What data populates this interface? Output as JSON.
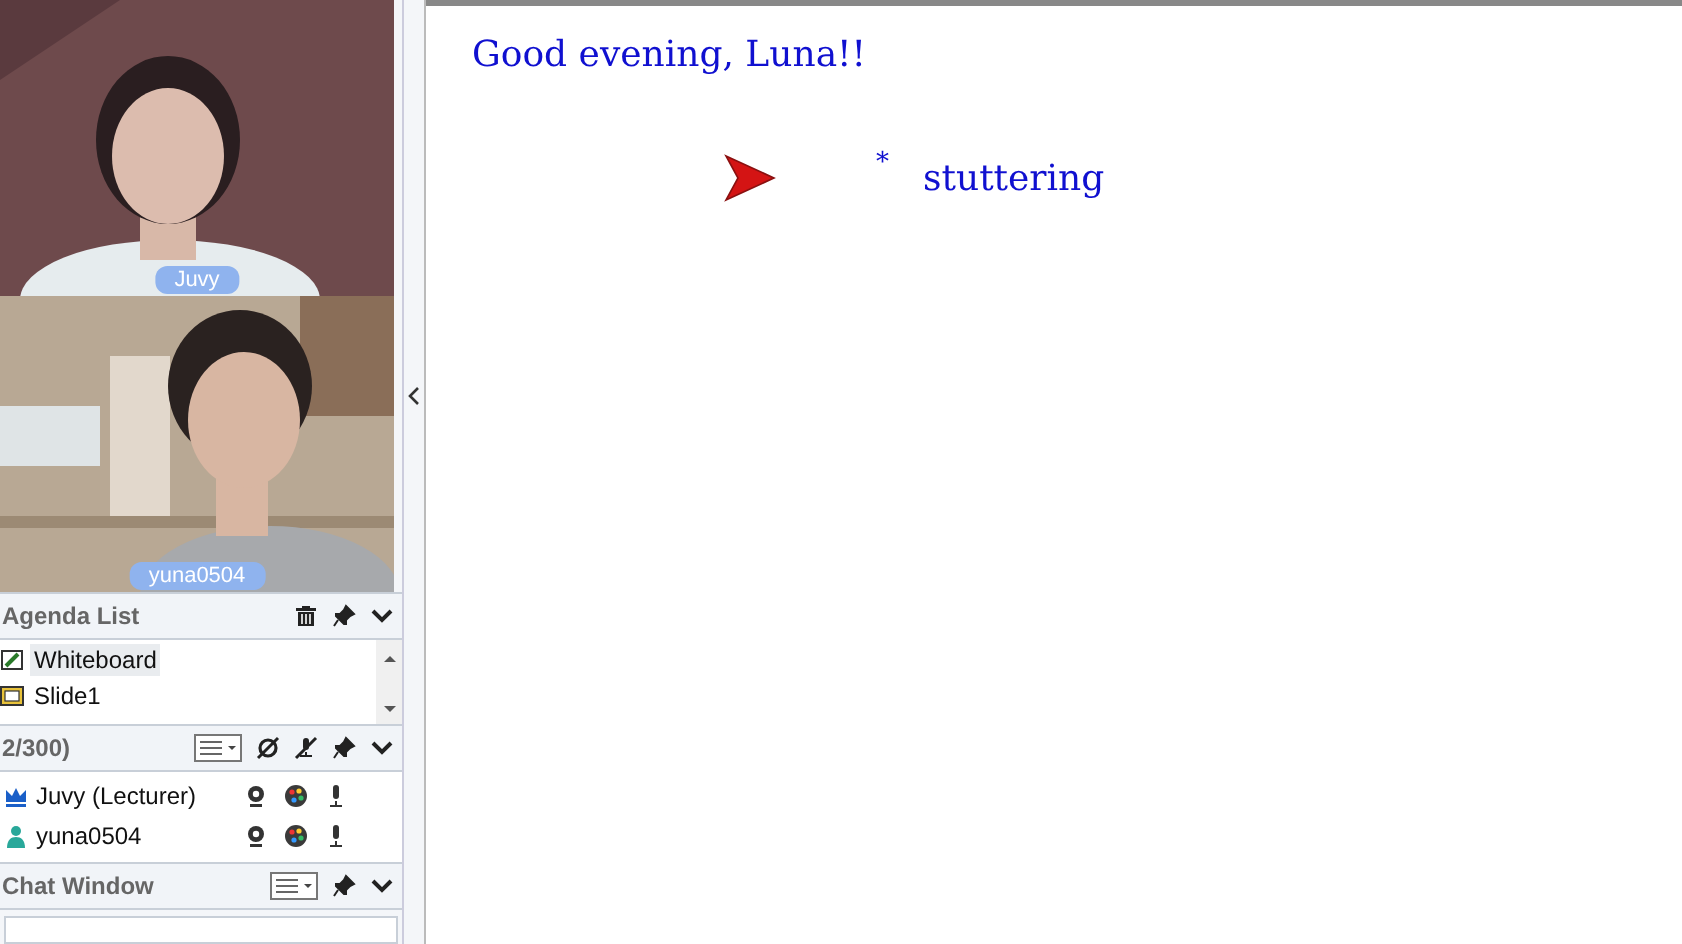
{
  "videos": [
    {
      "name": "Juvy",
      "kind": "lecturer"
    },
    {
      "name": "yuna0504",
      "kind": "student"
    }
  ],
  "agenda": {
    "title": "Agenda List",
    "items": [
      {
        "label": "Whiteboard",
        "kind": "whiteboard",
        "selected": true
      },
      {
        "label": "Slide1",
        "kind": "slide",
        "selected": false
      }
    ]
  },
  "participants": {
    "count": "2/300)",
    "rows": [
      {
        "name": "Juvy (Lecturer)",
        "kind": "lecturer"
      },
      {
        "name": "yuna0504",
        "kind": "student"
      }
    ]
  },
  "chat": {
    "title": "Chat Window"
  },
  "whiteboard": {
    "greeting": "Good evening, Luna!!",
    "mark": "*",
    "word": "stuttering"
  }
}
